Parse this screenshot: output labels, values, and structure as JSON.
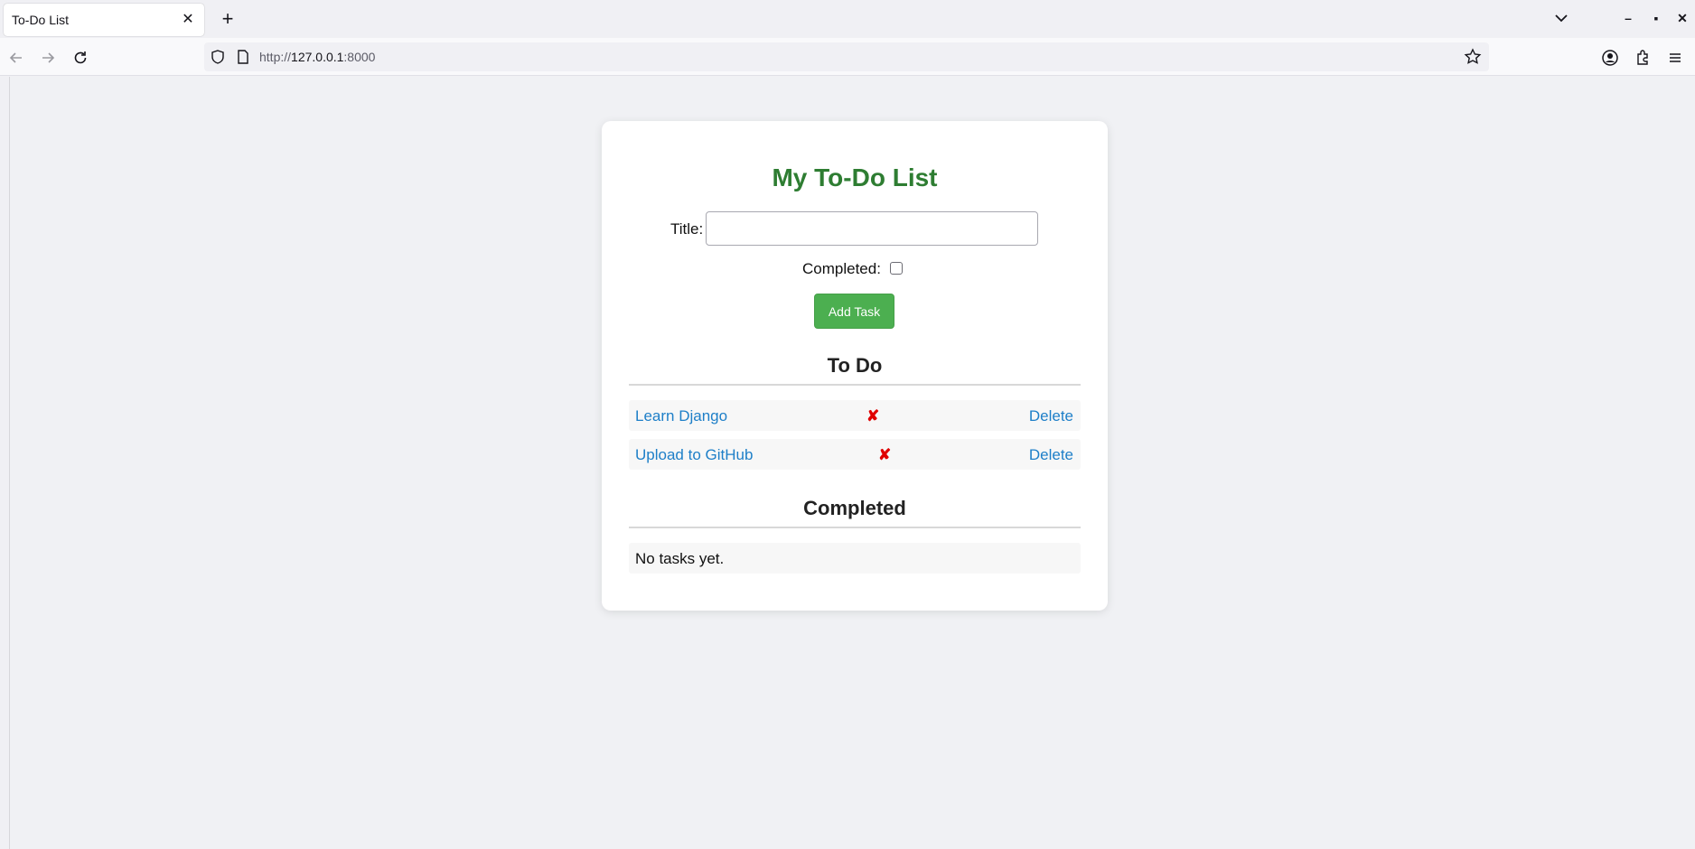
{
  "browser": {
    "tab_title": "To-Do List",
    "tab_close": "✕",
    "new_tab": "+",
    "url_scheme": "http://",
    "url_host": "127.0.0.1",
    "url_port": ":8000",
    "window_min": "–",
    "window_max": "▪",
    "window_close": "✕"
  },
  "page": {
    "heading": "My To-Do List",
    "form": {
      "title_label": "Title:",
      "title_value": "",
      "completed_label": "Completed:",
      "completed_checked": false,
      "add_button": "Add Task"
    },
    "todo": {
      "title": "To Do",
      "tasks": [
        {
          "title": "Learn Django",
          "status": "✘",
          "action": "Delete"
        },
        {
          "title": "Upload to GitHub",
          "status": "✘",
          "action": "Delete"
        }
      ]
    },
    "completed": {
      "title": "Completed",
      "empty_text": "No tasks yet."
    }
  },
  "colors": {
    "heading": "#2e7d32",
    "button": "#4caf50",
    "link": "#1e7fc8",
    "incomplete_mark": "#e00000",
    "page_bg": "#f0f1f4"
  }
}
